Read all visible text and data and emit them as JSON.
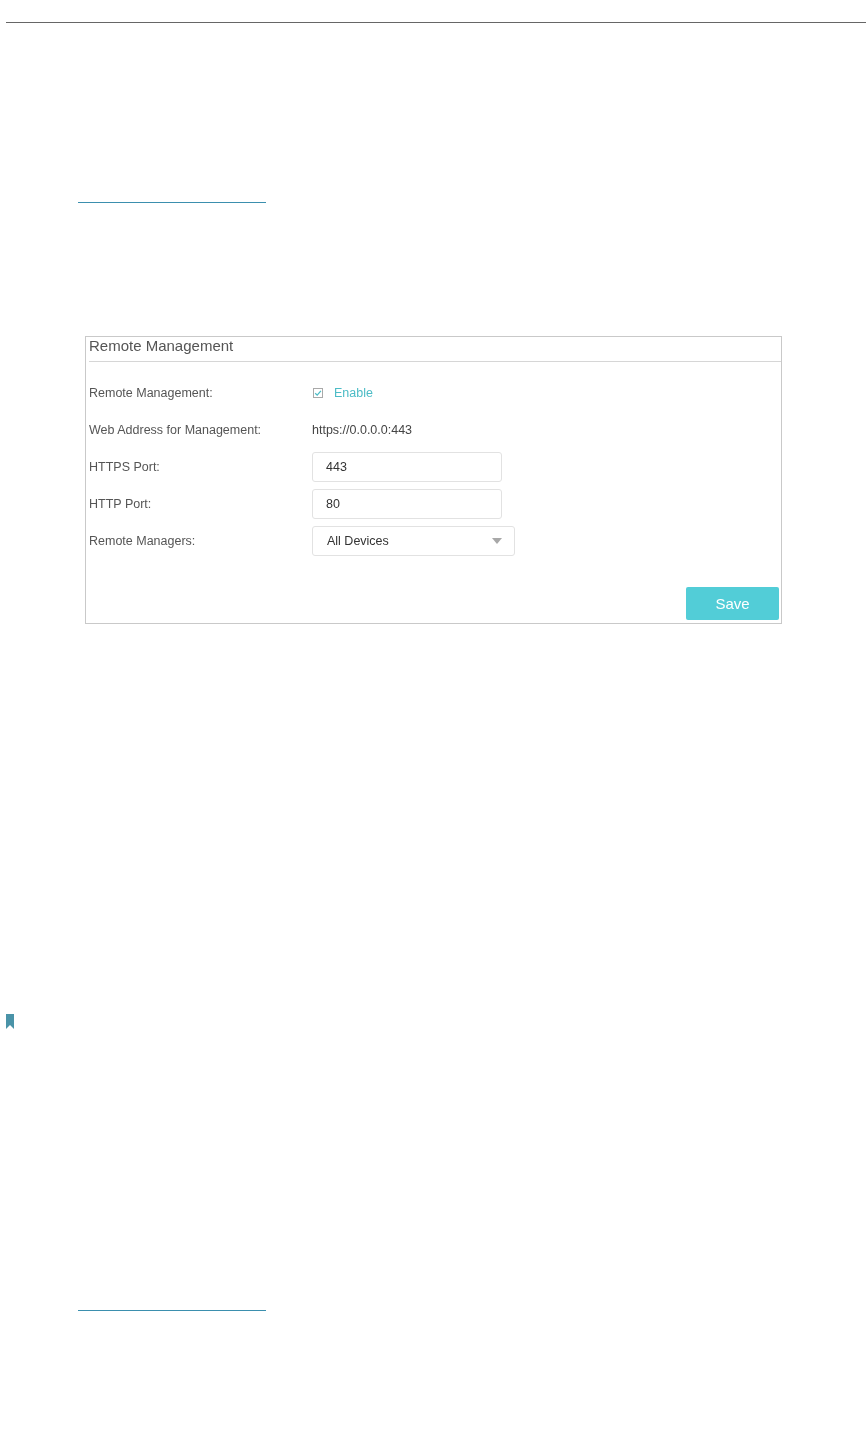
{
  "panel": {
    "title": "Remote Management",
    "fields": [
      {
        "kind": "checkbox",
        "label": "Remote Management:",
        "option": "Enable",
        "checked": true
      },
      {
        "kind": "text",
        "label": "Web Address for Management:",
        "value": "https://0.0.0.0:443"
      },
      {
        "kind": "input",
        "label": "HTTPS Port:",
        "value": "443"
      },
      {
        "kind": "input",
        "label": "HTTP Port:",
        "value": "80"
      },
      {
        "kind": "select",
        "label": "Remote Managers:",
        "value": "All Devices"
      }
    ],
    "buttons": [
      "Save"
    ]
  }
}
